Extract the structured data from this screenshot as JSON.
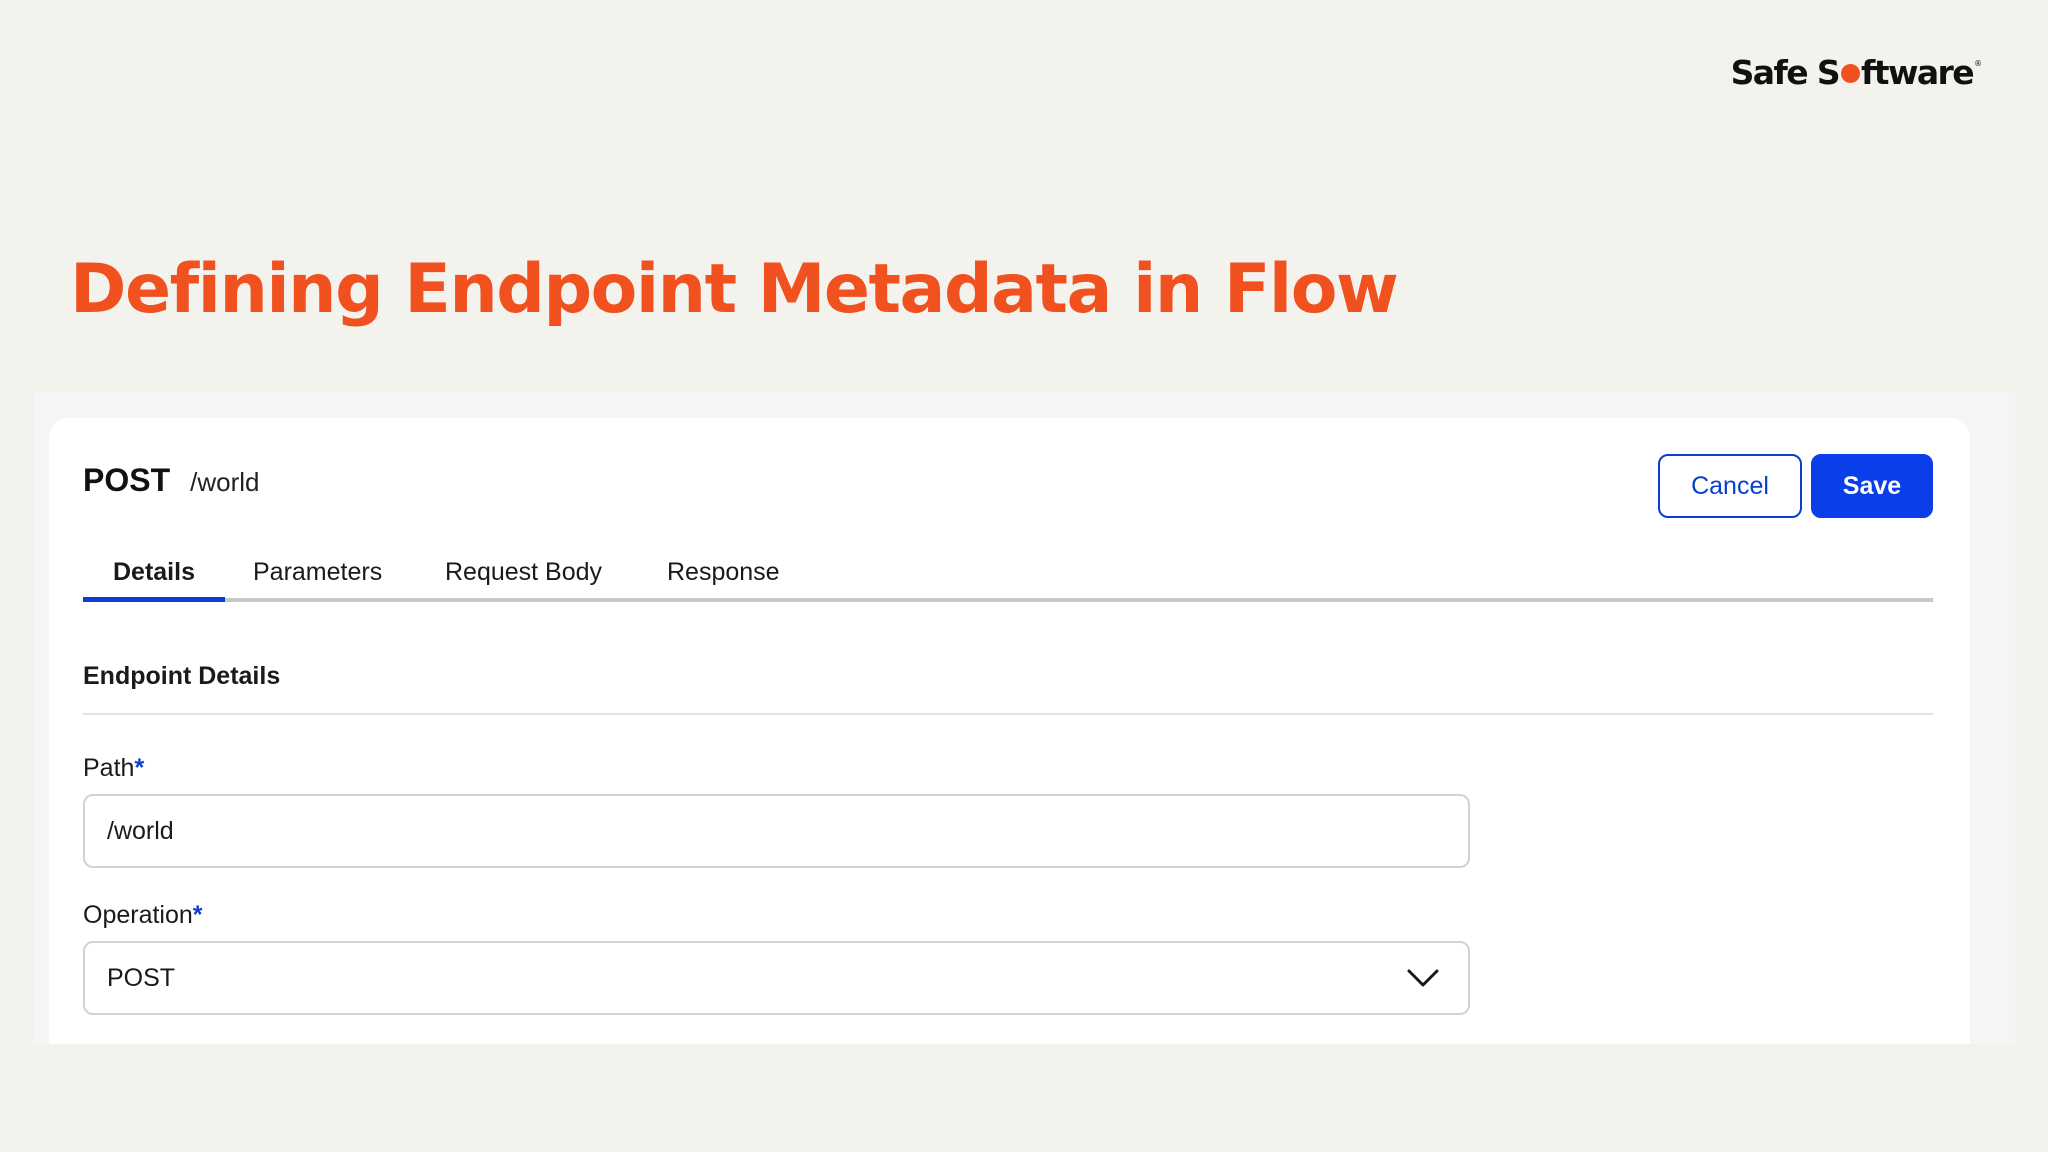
{
  "brand": {
    "logo_part1": "Safe S",
    "logo_part2": "ftware",
    "logo_trademark": "®",
    "accent_color": "#f0511f"
  },
  "slide": {
    "title": "Defining Endpoint Metadata in Flow"
  },
  "endpoint": {
    "method": "POST",
    "path": "/world"
  },
  "actions": {
    "cancel_label": "Cancel",
    "save_label": "Save"
  },
  "tabs": [
    {
      "label": "Details",
      "active": true
    },
    {
      "label": "Parameters",
      "active": false
    },
    {
      "label": "Request Body",
      "active": false
    },
    {
      "label": "Response",
      "active": false
    }
  ],
  "section": {
    "title": "Endpoint Details"
  },
  "fields": {
    "path": {
      "label": "Path",
      "required_marker": "*",
      "value": "/world"
    },
    "operation": {
      "label": "Operation",
      "required_marker": "*",
      "selected": "POST"
    }
  },
  "icons": {
    "operation_dropdown": "chevron-down-icon"
  },
  "colors": {
    "primary_blue": "#0a3ee8",
    "background": "#f4f2ed"
  }
}
